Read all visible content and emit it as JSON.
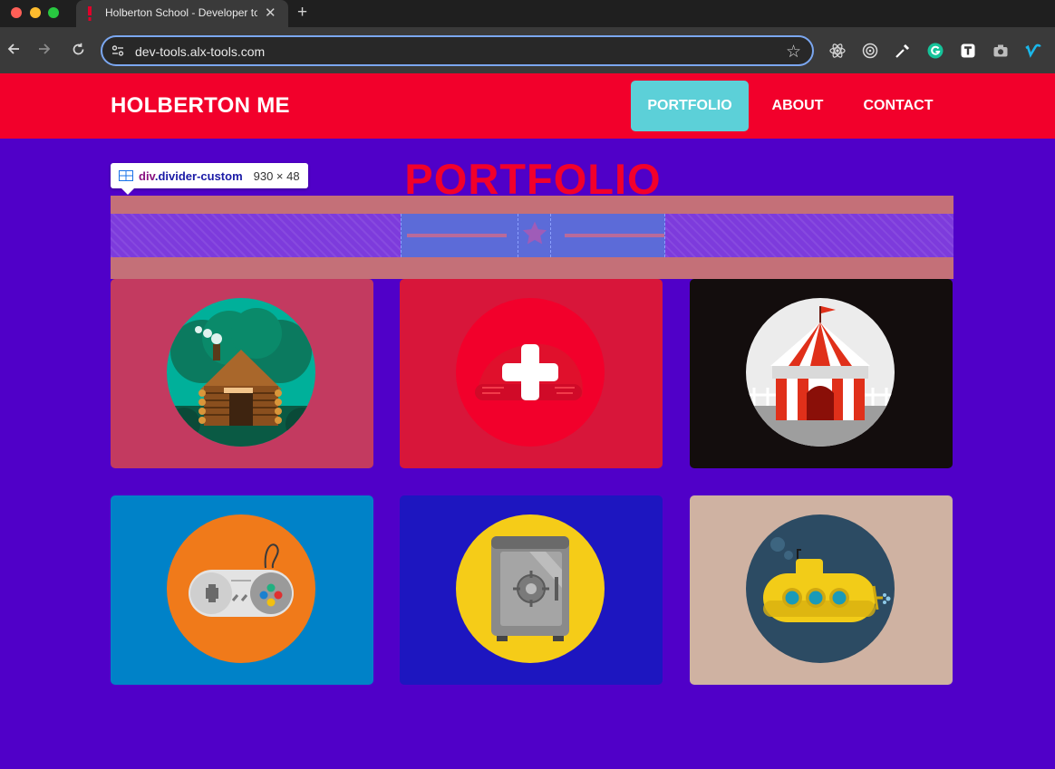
{
  "browser": {
    "tab_title": "Holberton School - Developer tools",
    "tab_close": "✕",
    "new_tab": "+",
    "url": "dev-tools.alx-tools.com",
    "star": "☆",
    "icons": [
      "back-arrow-icon",
      "forward-arrow-icon",
      "reload-icon",
      "site-settings-icon",
      "bookmark-star-icon",
      "react-icon",
      "target-icon",
      "eyedropper-icon",
      "grammarly-icon",
      "extension-t-icon",
      "camera-icon",
      "vimeo-icon"
    ]
  },
  "navbar": {
    "brand": "HOLBERTON ME",
    "links": [
      {
        "label": "PORTFOLIO",
        "active": true
      },
      {
        "label": "ABOUT",
        "active": false
      },
      {
        "label": "CONTACT",
        "active": false
      }
    ],
    "bg_color": "#f2002b",
    "active_color": "#5cd0d8"
  },
  "main": {
    "title": "PORTFOLIO",
    "divider_icon": "star-icon",
    "bg_color": "#5000c8"
  },
  "devtools_tooltip": {
    "tag": "div",
    "class_name": ".divider-custom",
    "size": "930 × 48"
  },
  "portfolio": [
    {
      "name": "cabin",
      "bg": "#c33a60"
    },
    {
      "name": "cake",
      "bg": "#d8163a"
    },
    {
      "name": "circus",
      "bg": "#130d0d"
    },
    {
      "name": "game",
      "bg": "#0082c8"
    },
    {
      "name": "safe",
      "bg": "#1d16c0"
    },
    {
      "name": "submarine",
      "bg": "#cfb2a2"
    }
  ]
}
